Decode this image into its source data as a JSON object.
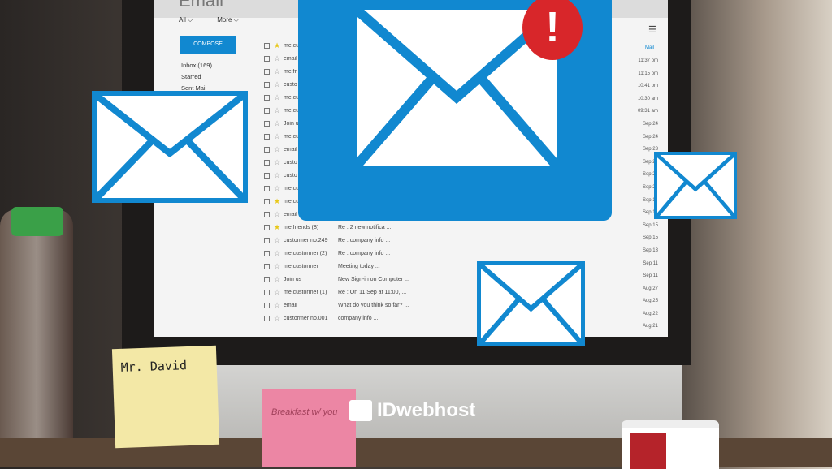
{
  "email_app": {
    "title": "Email",
    "tabs": [
      "All ⌵",
      "More ⌵"
    ],
    "compose": "COMPOSE",
    "nav": [
      "Inbox (169)",
      "Starred",
      "Sent Mail"
    ],
    "menu_icon": "hamburger-icon",
    "mail_link": "Mail",
    "rows": [
      {
        "sender": "me,cu",
        "subject": "",
        "starred": true
      },
      {
        "sender": "email",
        "subject": "",
        "starred": false
      },
      {
        "sender": "me,fr",
        "subject": "",
        "starred": false
      },
      {
        "sender": "custo",
        "subject": "",
        "starred": false
      },
      {
        "sender": "me,cu",
        "subject": "",
        "starred": false
      },
      {
        "sender": "me,cu",
        "subject": "",
        "starred": false
      },
      {
        "sender": "Join us",
        "subject": "",
        "starred": false
      },
      {
        "sender": "me,cu",
        "subject": "",
        "starred": false
      },
      {
        "sender": "email",
        "subject": "",
        "starred": false
      },
      {
        "sender": "custo",
        "subject": "",
        "starred": false
      },
      {
        "sender": "custo",
        "subject": "",
        "starred": false
      },
      {
        "sender": "me,cu",
        "subject": "",
        "starred": false
      },
      {
        "sender": "me,cu",
        "subject": "",
        "starred": true
      },
      {
        "sender": "email",
        "subject": "",
        "starred": false
      },
      {
        "sender": "me,friends (8)",
        "subject": "Re : 2 new notifica ...",
        "starred": true
      },
      {
        "sender": "custormer no.249",
        "subject": "Re : company info ...",
        "starred": false
      },
      {
        "sender": "me,custormer (2)",
        "subject": "Re : company info ...",
        "starred": false
      },
      {
        "sender": "me,custormer",
        "subject": "Meeting today ...",
        "starred": false
      },
      {
        "sender": "Join us",
        "subject": "New Sign-in on Computer ...",
        "starred": false
      },
      {
        "sender": "me,custormer (1)",
        "subject": "Re : On 11 Sep at 11:00, ...",
        "starred": false
      },
      {
        "sender": "email",
        "subject": "What do you think so far? ...",
        "starred": false
      },
      {
        "sender": "custormer no.001",
        "subject": "company info ...",
        "starred": false
      }
    ],
    "dates": [
      "11:37 pm",
      "11:15 pm",
      "10:41 pm",
      "10:30 am",
      "09:31 am",
      "Sep 24",
      "Sep 24",
      "Sep 23",
      "Sep 22",
      "Sep 22",
      "Sep 21",
      "Sep 18",
      "Sep 16",
      "Sep 15",
      "Sep 15",
      "Sep 13",
      "Sep 11",
      "Sep 11",
      "Aug 27",
      "Aug 25",
      "Aug 22",
      "Aug 21",
      "Aug 21"
    ]
  },
  "overlay": {
    "badge": "!",
    "accent": "#1188d0",
    "badge_color": "#d8262a"
  },
  "sticky_note": "Mr. David",
  "pink_note": "Breakfast w/ you",
  "logo": "IDwebhost"
}
